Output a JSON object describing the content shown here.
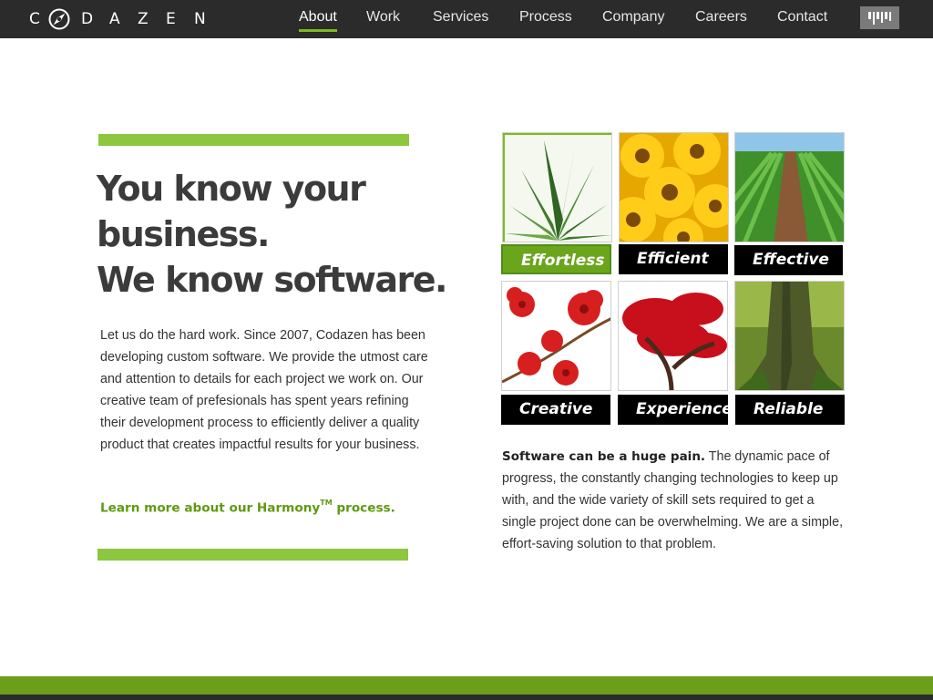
{
  "brand": {
    "letters": [
      "C",
      "D",
      "A",
      "Z",
      "E",
      "N"
    ],
    "logo_icon": "compass-logo-icon",
    "accent_color": "#8dc63f",
    "link_color": "#5f9a10",
    "header_color": "#2b2b2b"
  },
  "nav": {
    "items": [
      {
        "label": "About",
        "active": true
      },
      {
        "label": "Work",
        "active": false
      },
      {
        "label": "Services",
        "active": false
      },
      {
        "label": "Process",
        "active": false
      },
      {
        "label": "Company",
        "active": false
      },
      {
        "label": "Careers",
        "active": false
      },
      {
        "label": "Contact",
        "active": false
      }
    ],
    "menu_icon": "barcode-menu-icon"
  },
  "hero": {
    "headline": [
      "You know your",
      "business.",
      "We know software."
    ],
    "intro": "Let us do the hard work.  Since 2007, Codazen has been developing custom software. We provide the utmost care and attention to details for each project we work on. Our creative team of prefesionals has spent years refining their development process to efficiently deliver a quality product that creates impactful results for your business.",
    "link": {
      "before": "Learn more about our Harmony",
      "tm": "TM",
      "after": " process."
    }
  },
  "tiles": [
    {
      "label": "Effortless",
      "image": "aloe-plant-photo"
    },
    {
      "label": "Efficient",
      "image": "sunflowers-photo"
    },
    {
      "label": "Effective",
      "image": "crop-field-photo"
    },
    {
      "label": "Creative",
      "image": "red-orchids-photo"
    },
    {
      "label": "Experienced",
      "image": "red-maple-tree-photo"
    },
    {
      "label": "Reliable",
      "image": "mossy-tree-trunk-photo"
    }
  ],
  "pain": {
    "lead": "Software can be a huge pain.",
    "body": " The dynamic pace of progress, the constantly changing technologies to keep up with, and the wide variety of skill sets required to get a single project done can be overwhelming. We are a simple, effort-saving solution to that problem."
  }
}
